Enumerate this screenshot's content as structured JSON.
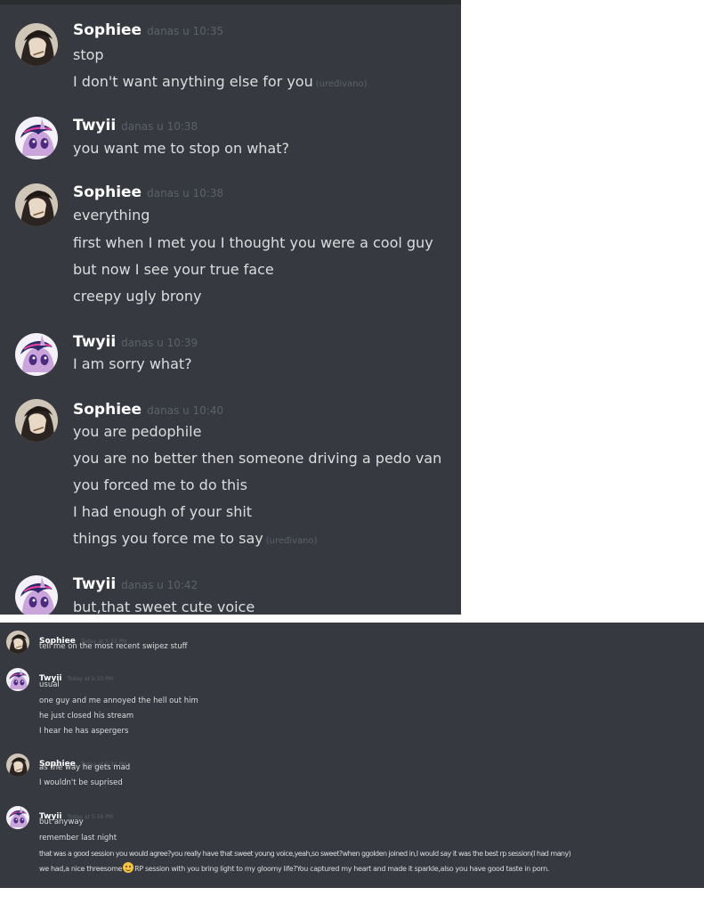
{
  "top_chat": {
    "messages": [
      {
        "author": "Sophiee",
        "timestamp": "danas u 10:35",
        "avatar": "sophiee-avatar",
        "lines": [
          {
            "text": "stop"
          },
          {
            "text": "I don't want anything else for you",
            "edited": "(uređivano)"
          }
        ]
      },
      {
        "author": "Twyii",
        "timestamp": "danas u 10:38",
        "avatar": "twyii-avatar",
        "lines": [
          {
            "text": "you want me to stop on what?"
          }
        ]
      },
      {
        "author": "Sophiee",
        "timestamp": "danas u 10:38",
        "avatar": "sophiee-avatar",
        "lines": [
          {
            "text": "everything"
          },
          {
            "text": "first when I met you I thought you  were a cool guy"
          },
          {
            "text": "but now I see your true face"
          },
          {
            "text": "creepy ugly brony"
          }
        ]
      },
      {
        "author": "Twyii",
        "timestamp": "danas u 10:39",
        "avatar": "twyii-avatar",
        "lines": [
          {
            "text": "I am sorry what?"
          }
        ]
      },
      {
        "author": "Sophiee",
        "timestamp": "danas u 10:40",
        "avatar": "sophiee-avatar",
        "lines": [
          {
            "text": "you are pedophile"
          },
          {
            "text": "you are no better then someone driving a pedo van"
          },
          {
            "text": "you forced me to do this"
          },
          {
            "text": "I had enough of your shit"
          },
          {
            "text": "things you force me to say",
            "edited": "(uređivano)"
          }
        ]
      },
      {
        "author": "Twyii",
        "timestamp": "danas u 10:42",
        "avatar": "twyii-avatar",
        "lines": [
          {
            "text": "but,that sweet cute voice"
          }
        ]
      }
    ]
  },
  "bottom_chat": {
    "messages": [
      {
        "author": "Sophiee",
        "timestamp": "Today at 5:33 PM",
        "avatar": "sophiee-avatar",
        "lines": [
          {
            "text": "tell me on the most recent swipez stuff"
          }
        ]
      },
      {
        "author": "Twyii",
        "timestamp": "Today at 5:33 PM",
        "avatar": "twyii-avatar",
        "lines": [
          {
            "text": "usual"
          },
          {
            "text": "one guy and me annoyed the hell out him"
          },
          {
            "text": "he just closed his stream"
          },
          {
            "text": "I hear he has aspergers"
          }
        ]
      },
      {
        "author": "Sophiee",
        "timestamp": "Today at 5:34 PM",
        "avatar": "sophiee-avatar",
        "lines": [
          {
            "text": "as the way he gets mad"
          },
          {
            "text": "I wouldn't be suprised"
          }
        ]
      },
      {
        "author": "Twyii",
        "timestamp": "Today at 5:34 PM",
        "avatar": "twyii-avatar",
        "lines": [
          {
            "text": "but anyway"
          },
          {
            "text": "remember last night"
          },
          {
            "text": "that was a good session you would agree?you really have that sweet young voice,yeah,so sweet?when ggolden joined in,I would say it was the best rp session(I had many)"
          },
          {
            "text": "we had,a nice threesome",
            "emoji": "slightly-smiling-emoji",
            "text_after": "RP session with you bring light to my gloomy life?You captured my heart and made it sparkle,also you have good taste in porn."
          }
        ]
      }
    ]
  },
  "colors": {
    "background": "#36393f",
    "username": "#ffffff",
    "message_text": "#dcddde",
    "timestamp": "#5c6269"
  }
}
